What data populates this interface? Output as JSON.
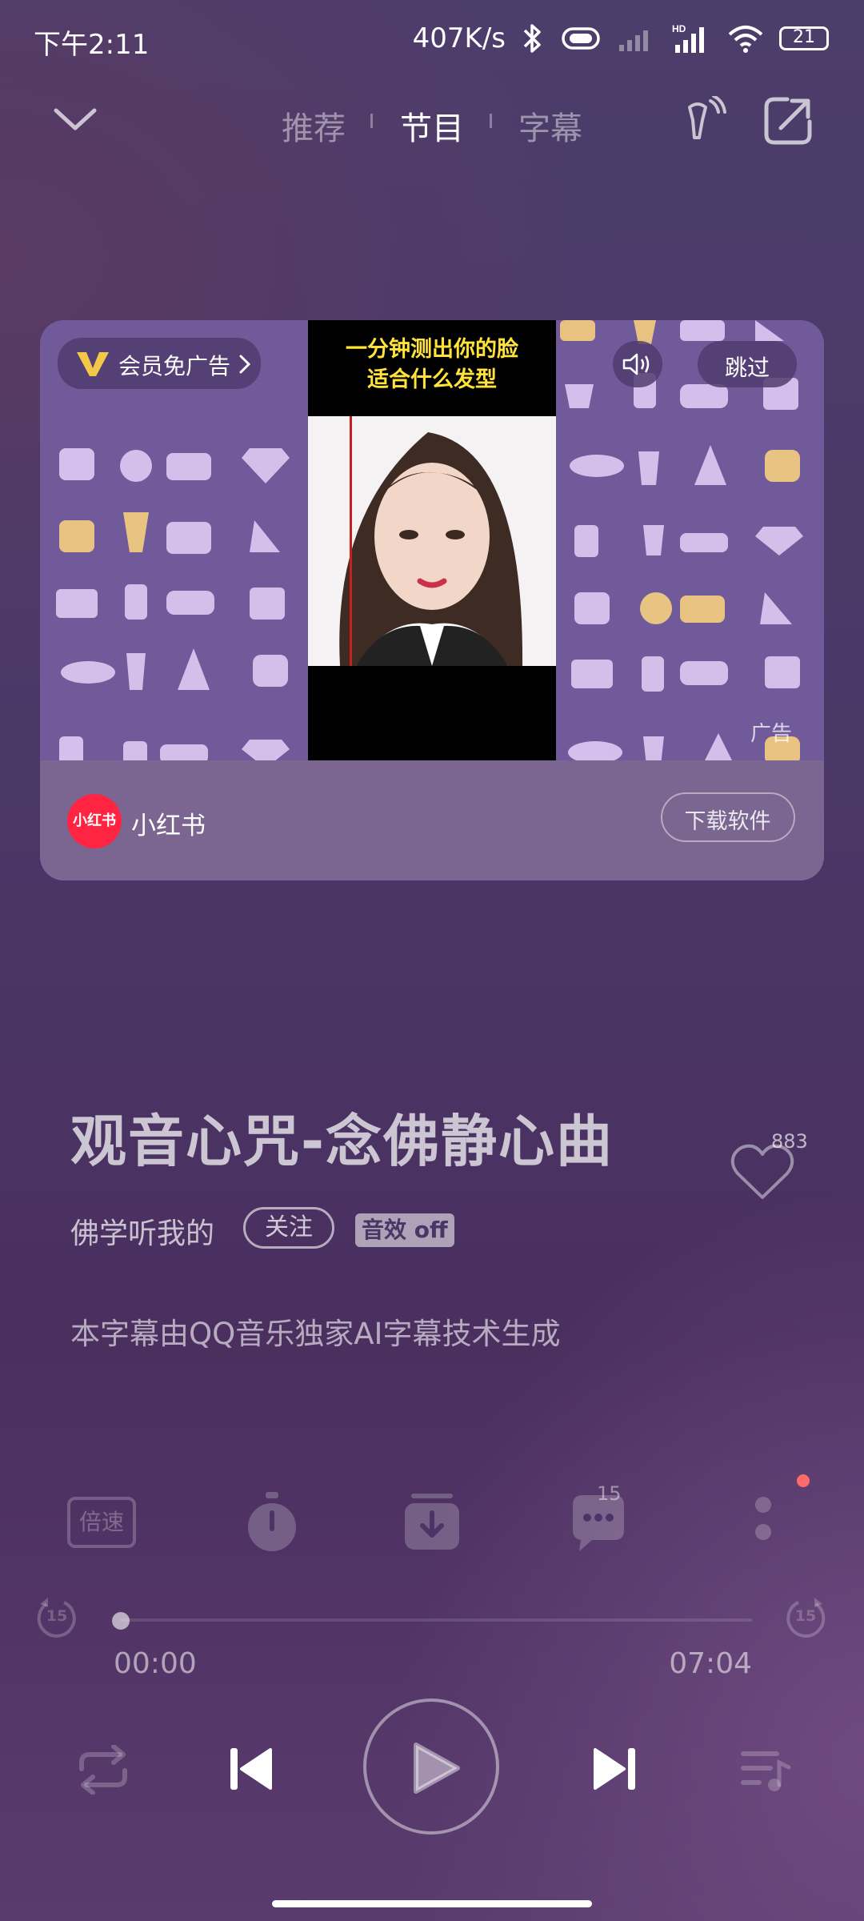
{
  "status_bar": {
    "time": "下午2:11",
    "speed": "407K/s",
    "battery": "21"
  },
  "nav": {
    "tabs": [
      {
        "label": "推荐",
        "active": false
      },
      {
        "label": "节目",
        "active": true
      },
      {
        "label": "字幕",
        "active": false
      }
    ]
  },
  "ad": {
    "vip_label": "会员免广告",
    "skip_label": "跳过",
    "ad_tag": "广告",
    "video_text_line1": "一分钟测出你的脸",
    "video_text_line2": "适合什么发型",
    "advertiser_logo_text": "小红书",
    "advertiser_name": "小红书",
    "download_label": "下载软件"
  },
  "song": {
    "title": "观音心咒-念佛静心曲",
    "artist": "佛学听我的",
    "follow_label": "关注",
    "sound_effect_label": "音效 off",
    "subtitle_note": "本字幕由QQ音乐独家AI字幕技术生成",
    "likes": "883"
  },
  "actions": {
    "speed_label": "倍速",
    "comment_count": "15"
  },
  "player": {
    "elapsed": "00:00",
    "duration": "07:04",
    "progress": 0,
    "skip_back_seconds": "15",
    "skip_forward_seconds": "15"
  },
  "colors": {
    "accent_red": "#ff2442",
    "notification_dot": "#ff6b6b"
  }
}
